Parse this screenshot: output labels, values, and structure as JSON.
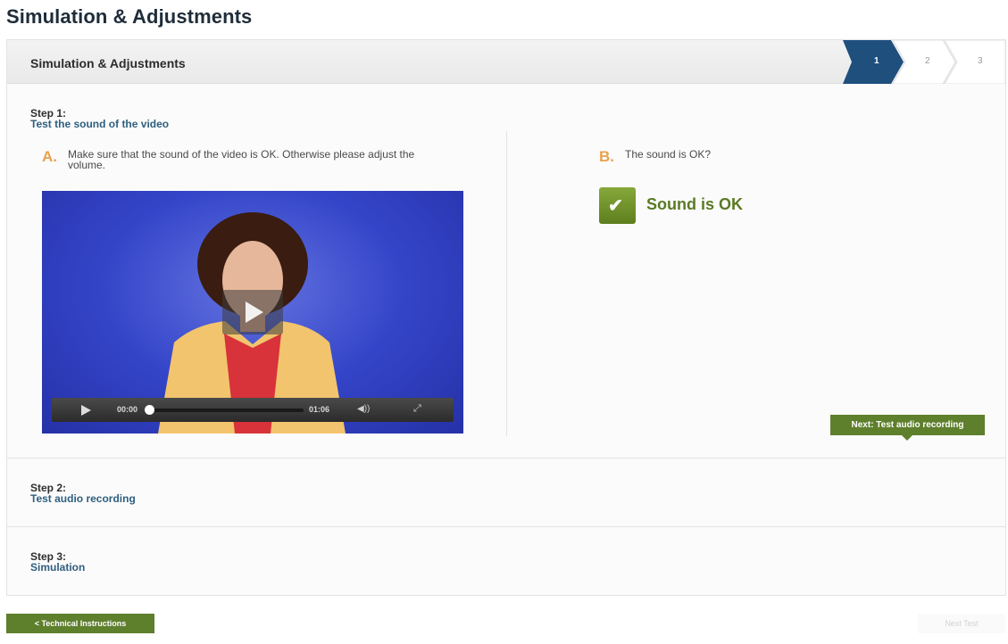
{
  "page": {
    "title": "Simulation & Adjustments"
  },
  "panel": {
    "header_title": "Simulation & Adjustments",
    "stepper": [
      "1",
      "2",
      "3"
    ],
    "active_step": 1,
    "accent_color": "#1f4f7d"
  },
  "step1": {
    "heading": "Step 1:",
    "subtitle": "Test the sound of the video",
    "a": {
      "letter": "A.",
      "text_line1": "Make sure that the sound of the video is OK. Otherwise please adjust the",
      "text_line2": "volume."
    },
    "video": {
      "current_time": "00:00",
      "duration": "01:06",
      "progress": 0
    },
    "b": {
      "letter": "B.",
      "question": "The sound is OK?"
    },
    "ok_label": "Sound is OK",
    "next_button": "Next: Test audio recording"
  },
  "step2": {
    "heading": "Step 2:",
    "subtitle": "Test audio recording"
  },
  "step3": {
    "heading": "Step 3:",
    "subtitle": "Simulation"
  },
  "footer": {
    "back_button": "<   Technical Instructions",
    "next_button": "Next Test"
  },
  "colors": {
    "green": "#5e7f2c",
    "orange": "#e7a24e",
    "link_blue": "#2f5f7e"
  }
}
